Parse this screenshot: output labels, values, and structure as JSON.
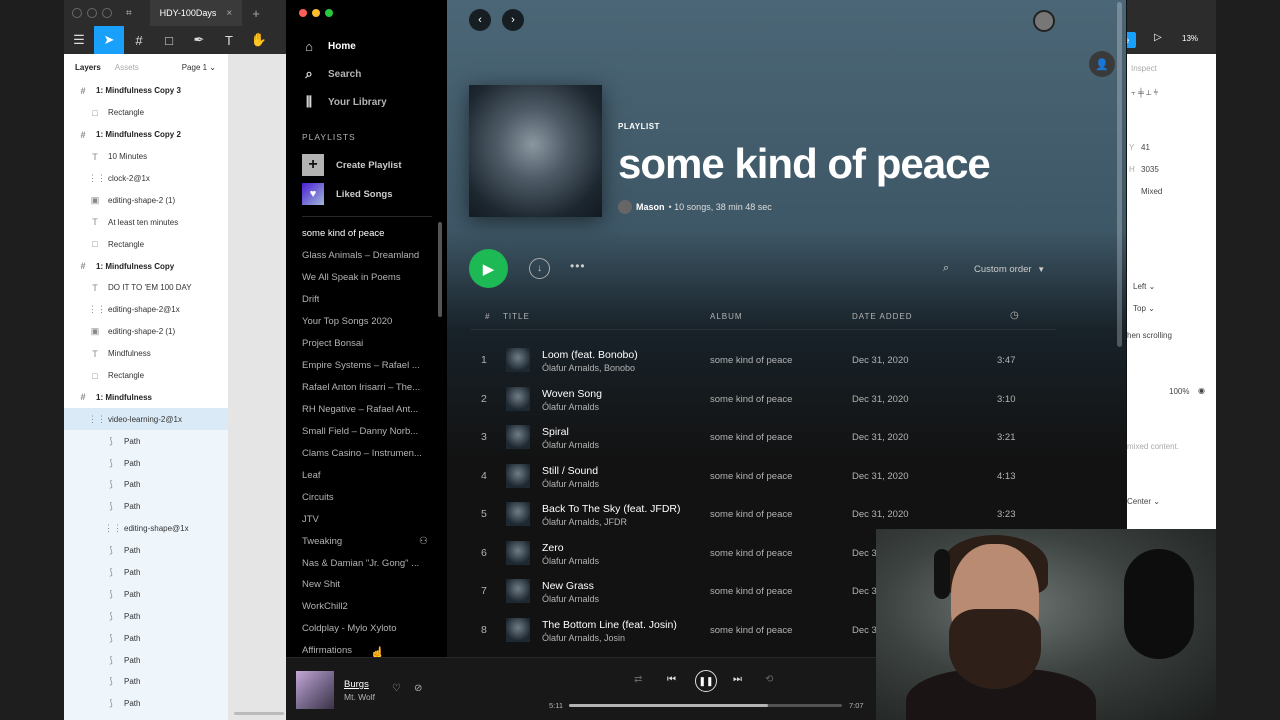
{
  "figma": {
    "tab_title": "HDY-100Days",
    "layers_tab": "Layers",
    "assets_tab": "Assets",
    "page_selector": "Page 1",
    "zoom": "13%",
    "share_label": "e",
    "inspect_tab": "Inspect",
    "layers": [
      {
        "name": "1: Mindfulness Copy 3",
        "type": "frame"
      },
      {
        "name": "Rectangle",
        "type": "rect"
      },
      {
        "name": "1: Mindfulness Copy 2",
        "type": "frame"
      },
      {
        "name": "10 Minutes",
        "type": "text"
      },
      {
        "name": "clock-2@1x",
        "type": "group"
      },
      {
        "name": "editing-shape-2 (1)",
        "type": "image"
      },
      {
        "name": "At least ten minutes",
        "type": "text"
      },
      {
        "name": "Rectangle",
        "type": "rect"
      },
      {
        "name": "1: Mindfulness Copy",
        "type": "frame"
      },
      {
        "name": "DO IT TO 'EM 100 DAY",
        "type": "text"
      },
      {
        "name": "editing-shape-2@1x",
        "type": "group"
      },
      {
        "name": "editing-shape-2 (1)",
        "type": "image"
      },
      {
        "name": "Mindfulness",
        "type": "text"
      },
      {
        "name": "Rectangle",
        "type": "rect"
      },
      {
        "name": "1: Mindfulness",
        "type": "frame"
      },
      {
        "name": "video-learning-2@1x",
        "type": "group",
        "selected": true
      },
      {
        "name": "Path",
        "type": "path"
      },
      {
        "name": "Path",
        "type": "path"
      },
      {
        "name": "Path",
        "type": "path"
      },
      {
        "name": "Path",
        "type": "path"
      },
      {
        "name": "editing-shape@1x",
        "type": "group"
      },
      {
        "name": "Path",
        "type": "path"
      },
      {
        "name": "Path",
        "type": "path"
      },
      {
        "name": "Path",
        "type": "path"
      },
      {
        "name": "Path",
        "type": "path"
      },
      {
        "name": "Path",
        "type": "path"
      },
      {
        "name": "Path",
        "type": "path"
      },
      {
        "name": "Path",
        "type": "path"
      },
      {
        "name": "Path",
        "type": "path"
      },
      {
        "name": "Path",
        "type": "path"
      }
    ],
    "right_panel": {
      "y_label": "Y",
      "y_value": "41",
      "h_label": "H",
      "h_value": "3035",
      "mixed": "Mixed",
      "left": "Left",
      "top": "Top",
      "scrolling": "hen scrolling",
      "opacity": "100%",
      "mixed_content": "mixed content.",
      "center": "Center"
    }
  },
  "spotify": {
    "nav": [
      {
        "label": "Home",
        "icon": "home-icon"
      },
      {
        "label": "Search",
        "icon": "search-icon"
      },
      {
        "label": "Your Library",
        "icon": "library-icon"
      }
    ],
    "playlists_heading": "PLAYLISTS",
    "create_playlist": "Create Playlist",
    "liked_songs": "Liked Songs",
    "playlists": [
      "some kind of peace",
      "Glass Animals – Dreamland",
      "We All Speak in Poems",
      "Drift",
      "Your Top Songs 2020",
      "Project Bonsai",
      "Empire Systems – Rafael ...",
      "Rafael Anton Irisarri – The...",
      "RH Negative – Rafael Ant...",
      "Small Field – Danny Norb...",
      "Clams Casino – Instrumen...",
      "Leaf",
      "Circuits",
      "JTV",
      "Tweaking",
      "Nas & Damian \"Jr. Gong\" ...",
      "New Shit",
      "WorkChill2",
      "Coldplay - Mylo Xyloto",
      "Affirmations"
    ],
    "playlist": {
      "type_label": "PLAYLIST",
      "title": "some kind of peace",
      "owner": "Mason",
      "meta": "• 10 songs, 38 min 48 sec"
    },
    "sort_label": "Custom order",
    "columns": {
      "num": "#",
      "title": "TITLE",
      "album": "ALBUM",
      "date": "DATE ADDED"
    },
    "tracks": [
      {
        "num": "1",
        "title": "Loom (feat. Bonobo)",
        "artist": "Ólafur Arnalds, Bonobo",
        "album": "some kind of peace",
        "date": "Dec 31, 2020",
        "duration": "3:47"
      },
      {
        "num": "2",
        "title": "Woven Song",
        "artist": "Ólafur Arnalds",
        "album": "some kind of peace",
        "date": "Dec 31, 2020",
        "duration": "3:10"
      },
      {
        "num": "3",
        "title": "Spiral",
        "artist": "Ólafur Arnalds",
        "album": "some kind of peace",
        "date": "Dec 31, 2020",
        "duration": "3:21"
      },
      {
        "num": "4",
        "title": "Still / Sound",
        "artist": "Ólafur Arnalds",
        "album": "some kind of peace",
        "date": "Dec 31, 2020",
        "duration": "4:13"
      },
      {
        "num": "5",
        "title": "Back To The Sky (feat. JFDR)",
        "artist": "Ólafur Arnalds, JFDR",
        "album": "some kind of peace",
        "date": "Dec 31, 2020",
        "duration": "3:23"
      },
      {
        "num": "6",
        "title": "Zero",
        "artist": "Ólafur Arnalds",
        "album": "some kind of peace",
        "date": "Dec 3",
        "duration": ""
      },
      {
        "num": "7",
        "title": "New Grass",
        "artist": "Ólafur Arnalds",
        "album": "some kind of peace",
        "date": "Dec 3",
        "duration": ""
      },
      {
        "num": "8",
        "title": "The Bottom Line (feat. Josin)",
        "artist": "Ólafur Arnalds, Josin",
        "album": "some kind of peace",
        "date": "Dec 3",
        "duration": ""
      }
    ],
    "now_playing": {
      "title": "Burgs",
      "artist": "Mt. Wolf",
      "current_time": "5:11",
      "total_time": "7:07",
      "progress": 0.73
    }
  }
}
